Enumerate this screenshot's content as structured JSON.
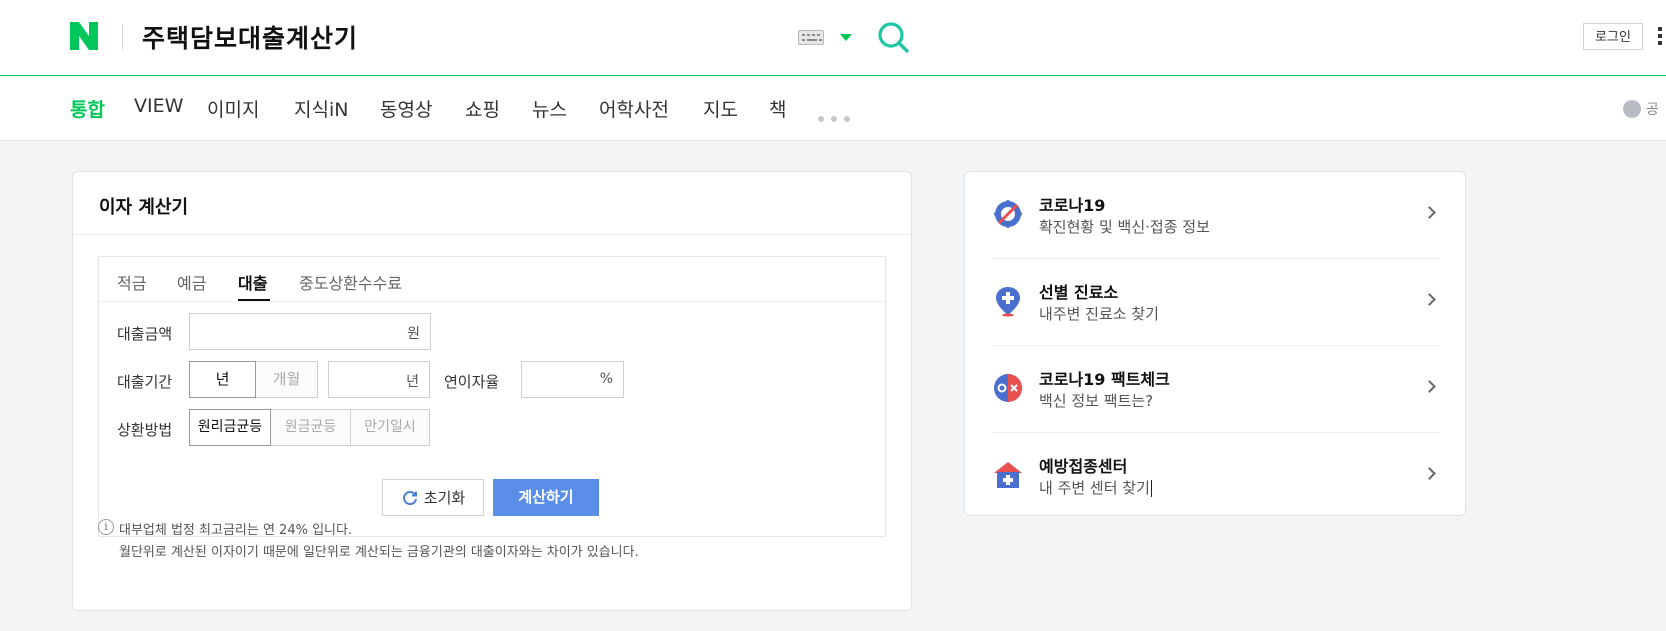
{
  "header": {
    "logo_letter": "N",
    "query": "주택담보대출계산기",
    "login_label": "로그인",
    "brand_color": "#03c75a"
  },
  "nav": {
    "items": [
      "통합",
      "VIEW",
      "이미지",
      "지식iN",
      "동영상",
      "쇼핑",
      "뉴스",
      "어학사전",
      "지도",
      "책"
    ],
    "active_index": 0,
    "share_label": "공"
  },
  "calculator": {
    "title": "이자 계산기",
    "tabs": [
      "적금",
      "예금",
      "대출",
      "중도상환수수료"
    ],
    "active_tab_index": 2,
    "loan_amount_label": "대출금액",
    "loan_amount_value": "",
    "loan_amount_unit": "원",
    "loan_term_label": "대출기간",
    "term_unit_options": [
      "년",
      "개월"
    ],
    "term_unit_selected": "년",
    "loan_term_value": "",
    "loan_term_unit": "년",
    "rate_label": "연이자율",
    "rate_value": "",
    "rate_unit": "%",
    "repayment_label": "상환방법",
    "repayment_options": [
      "원리금균등",
      "원금균등",
      "만기일시"
    ],
    "repayment_selected": "원리금균등",
    "reset_label": "초기화",
    "calc_label": "계산하기",
    "notes": [
      "대부업체 법정 최고금리는 연 24% 입니다.",
      "월단위로 계산된 이자이기 때문에 일단위로 계산되는 금융기관의 대출이자와는 차이가 있습니다."
    ],
    "accent_color": "#5b8ee8"
  },
  "covid": {
    "items": [
      {
        "title": "코로나19",
        "subtitle": "확진현황 및 백신·접종 정보",
        "icon": "virus-icon"
      },
      {
        "title": "선별 진료소",
        "subtitle": "내주변 진료소 찾기",
        "icon": "clinic-pin-icon"
      },
      {
        "title": "코로나19 팩트체크",
        "subtitle": "백신 정보 팩트는?",
        "icon": "ox-icon"
      },
      {
        "title": "예방접종센터",
        "subtitle": "내 주변 센터 찾기",
        "icon": "vaccination-center-icon"
      }
    ]
  }
}
